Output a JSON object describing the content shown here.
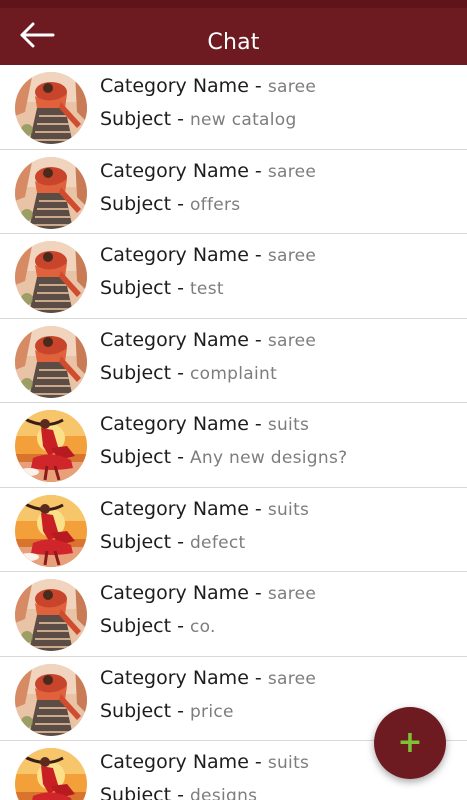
{
  "colors": {
    "appbar": "#6d1b21",
    "fab_icon": "#7ec235"
  },
  "header": {
    "title": "Chat",
    "back_icon": "arrow-left-icon"
  },
  "labels": {
    "category": "Category Name - ",
    "subject": "Subject - "
  },
  "chats": [
    {
      "category": "saree",
      "subject": "new catalog",
      "thumbnail": "saree-thumbnail"
    },
    {
      "category": "saree",
      "subject": "offers",
      "thumbnail": "saree-thumbnail"
    },
    {
      "category": "saree",
      "subject": "test",
      "thumbnail": "saree-thumbnail"
    },
    {
      "category": "saree",
      "subject": "complaint",
      "thumbnail": "saree-thumbnail"
    },
    {
      "category": "suits",
      "subject": "Any new designs?",
      "thumbnail": "suits-thumbnail"
    },
    {
      "category": "suits",
      "subject": "defect",
      "thumbnail": "suits-thumbnail"
    },
    {
      "category": "saree",
      "subject": "co.",
      "thumbnail": "saree-thumbnail"
    },
    {
      "category": "saree",
      "subject": "price",
      "thumbnail": "saree-thumbnail"
    },
    {
      "category": "suits",
      "subject": "designs",
      "thumbnail": "suits-thumbnail"
    }
  ],
  "fab": {
    "label": "+",
    "icon": "plus-icon"
  }
}
